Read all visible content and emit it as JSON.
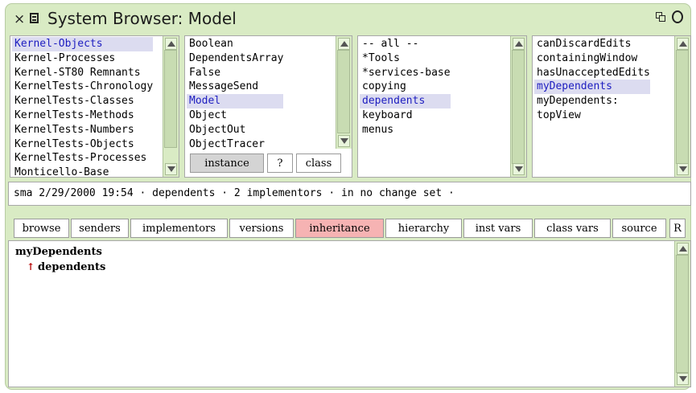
{
  "window": {
    "title": "System Browser: Model"
  },
  "categories": {
    "items": [
      "Kernel-Objects",
      "Kernel-Processes",
      "Kernel-ST80 Remnants",
      "KernelTests-Chronology",
      "KernelTests-Classes",
      "KernelTests-Methods",
      "KernelTests-Numbers",
      "KernelTests-Objects",
      "KernelTests-Processes",
      "Monticello-Base"
    ],
    "selected": 0
  },
  "classes": {
    "items": [
      "Boolean",
      "DependentsArray",
      "False",
      "MessageSend",
      "Model",
      "Object",
      "ObjectOut",
      "ObjectTracer"
    ],
    "selected": 4
  },
  "class_toggle": {
    "instance": "instance",
    "help": "?",
    "class": "class"
  },
  "protocols": {
    "items": [
      "-- all --",
      "*Tools",
      "*services-base",
      "copying",
      "dependents",
      "keyboard",
      "menus"
    ],
    "selected": 4
  },
  "methods": {
    "items": [
      "canDiscardEdits",
      "containingWindow",
      "hasUnacceptedEdits",
      "myDependents",
      "myDependents:",
      "topView"
    ],
    "selected": 3
  },
  "info_line": "sma 2/29/2000 19:54 · dependents · 2 implementors · in no change set ·",
  "toolbar": {
    "browse": "browse",
    "senders": "senders",
    "implementors": "implementors",
    "versions": "versions",
    "inheritance": "inheritance",
    "hierarchy": "hierarchy",
    "inst_vars": "inst vars",
    "class_vars": "class vars",
    "source": "source",
    "r": "R"
  },
  "code": {
    "line1": "myDependents",
    "arrow": "↑",
    "line2": "dependents"
  },
  "colors": {
    "window_bg": "#d9ebc4",
    "selection_bg": "#dcdcf0",
    "selection_text": "#1d1dc0",
    "inheritance_highlight": "#f6b3b3",
    "return_arrow": "#b40000"
  }
}
